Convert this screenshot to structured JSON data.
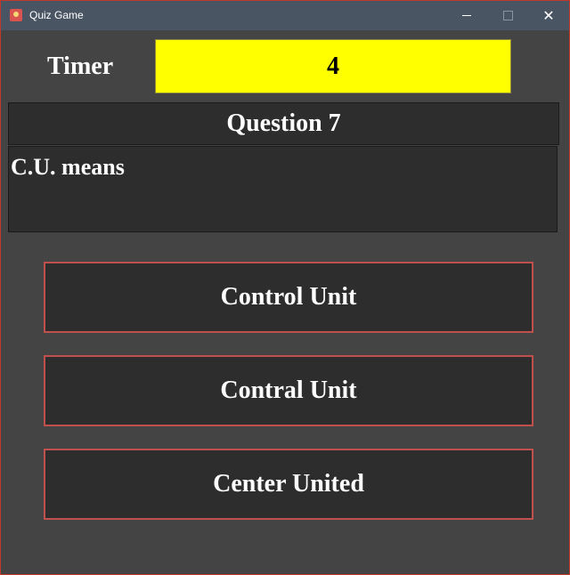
{
  "window": {
    "title": "Quiz Game",
    "minimize": "—",
    "maximize": "□",
    "close": "✕"
  },
  "timer": {
    "label": "Timer",
    "value": "4"
  },
  "question": {
    "header": "Question 7",
    "text": "C.U. means"
  },
  "options": [
    {
      "label": "Control Unit"
    },
    {
      "label": "Contral Unit"
    },
    {
      "label": "Center United"
    }
  ],
  "colors": {
    "background": "#444444",
    "timer_bg": "#ffff00",
    "panel_bg": "#2d2d2d",
    "option_border": "#c0504d",
    "titlebar_bg": "#4a5563"
  }
}
